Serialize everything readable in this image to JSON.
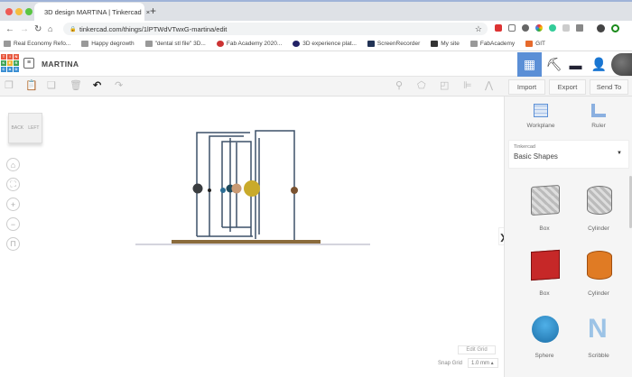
{
  "browser": {
    "tab_title": "3D design MARTINA | Tinkercad",
    "url": "tinkercad.com/things/1lPTWdVTwxG-martina/edit",
    "bookmarks": [
      "Real Economy Refo...",
      "Happy degrowth",
      "\"dental stl file\" 3D...",
      "Fab Academy 2020...",
      "3D experience plat...",
      "ScreenRecorder",
      "My site",
      "FabAcademy",
      "GIT"
    ]
  },
  "app": {
    "logo_letters": [
      "T",
      "I",
      "N",
      "K",
      "E",
      "R",
      "C",
      "A",
      "D"
    ],
    "design_title": "MARTINA",
    "actions": {
      "import": "Import",
      "export": "Export",
      "send_to": "Send To"
    },
    "viewcube": {
      "back": "BACK",
      "left": "LEFT"
    }
  },
  "panel": {
    "workplane": "Workplane",
    "ruler": "Ruler",
    "library_source": "Tinkercad",
    "library_selected": "Basic Shapes",
    "shapes": [
      {
        "label": "Box",
        "color": "#c8c8c8"
      },
      {
        "label": "Cylinder",
        "color": "#c8c8c8"
      },
      {
        "label": "Box",
        "color": "#c62828"
      },
      {
        "label": "Cylinder",
        "color": "#e07b24"
      },
      {
        "label": "Sphere",
        "color": "#2f8fd0"
      },
      {
        "label": "Scribble",
        "color": "#9cc3e6"
      }
    ]
  },
  "grid": {
    "edit_grid": "Edit Grid",
    "snap_grid_label": "Snap Grid",
    "snap_grid_value": "1.0 mm"
  },
  "colors": {
    "accent": "#5b8fd6"
  }
}
